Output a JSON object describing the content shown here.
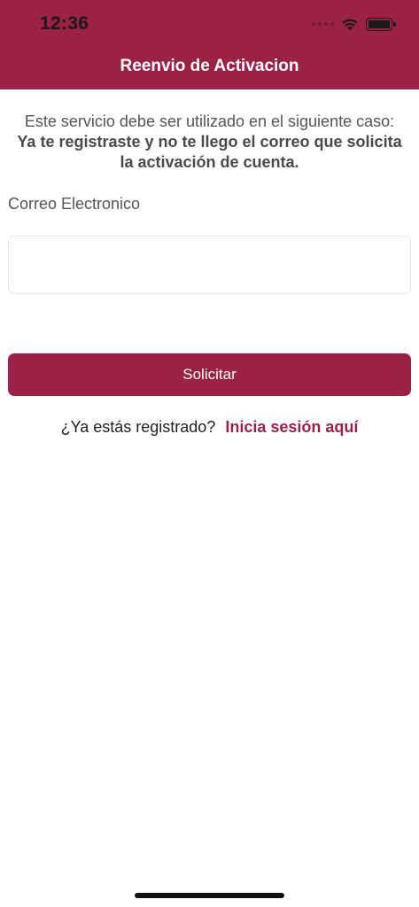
{
  "status_bar": {
    "time": "12:36",
    "icons": [
      "cellular-signal-icon",
      "wifi-icon",
      "battery-icon"
    ]
  },
  "nav": {
    "title": "Reenvio de Activacion"
  },
  "intro": {
    "text": "Este servicio debe ser utilizado en el siguiente caso:",
    "bold_text": "Ya te registraste y no te llego el correo que solicita la activación de cuenta."
  },
  "form": {
    "email_label": "Correo Electronico",
    "email_value": "",
    "email_placeholder": "",
    "submit_label": "Solicitar"
  },
  "footer": {
    "question": "¿Ya estás registrado?",
    "login_link": "Inicia sesión aquí"
  },
  "colors": {
    "brand": "#9b2246",
    "text": "#555555",
    "background": "#ffffff"
  }
}
